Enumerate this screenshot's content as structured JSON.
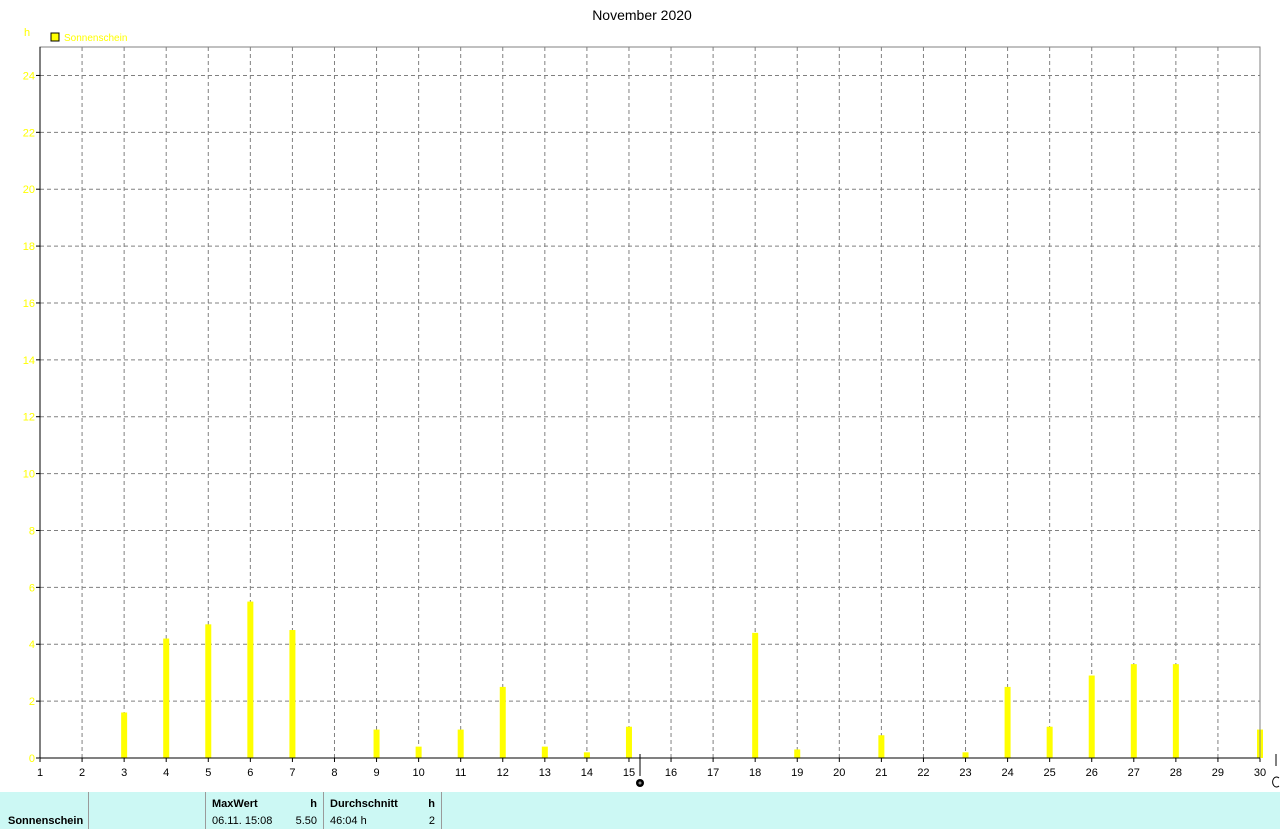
{
  "chart_data": {
    "type": "bar",
    "title": "November 2020",
    "ylabel": "h",
    "ylim": [
      0,
      25
    ],
    "yticks": [
      0,
      2,
      4,
      6,
      8,
      10,
      12,
      14,
      16,
      18,
      20,
      22,
      24
    ],
    "categories": [
      "1",
      "2",
      "3",
      "4",
      "5",
      "6",
      "7",
      "8",
      "9",
      "10",
      "11",
      "12",
      "13",
      "14",
      "15",
      "16",
      "17",
      "18",
      "19",
      "20",
      "21",
      "22",
      "23",
      "24",
      "25",
      "26",
      "27",
      "28",
      "29",
      "30"
    ],
    "series": [
      {
        "name": "Sonnenschein",
        "color": "#ffff00",
        "values": [
          0,
          0,
          1.6,
          4.2,
          4.7,
          5.5,
          4.5,
          0,
          1.0,
          0.4,
          1.0,
          2.5,
          0.4,
          0.2,
          1.1,
          0,
          0,
          4.4,
          0.3,
          0,
          0.8,
          0,
          0.2,
          2.5,
          1.1,
          2.9,
          3.3,
          3.3,
          0,
          1.0
        ]
      }
    ],
    "legend": "top-left",
    "grid": true
  },
  "footer": {
    "series_label": "Sonnenschein",
    "max_label": "MaxWert",
    "max_unit": "h",
    "max_date": "06.11.  15:08",
    "max_value": "5.50",
    "avg_label": "Durchschnitt",
    "avg_unit": "h",
    "avg_value": "46:04 h",
    "avg_extra": "2"
  }
}
